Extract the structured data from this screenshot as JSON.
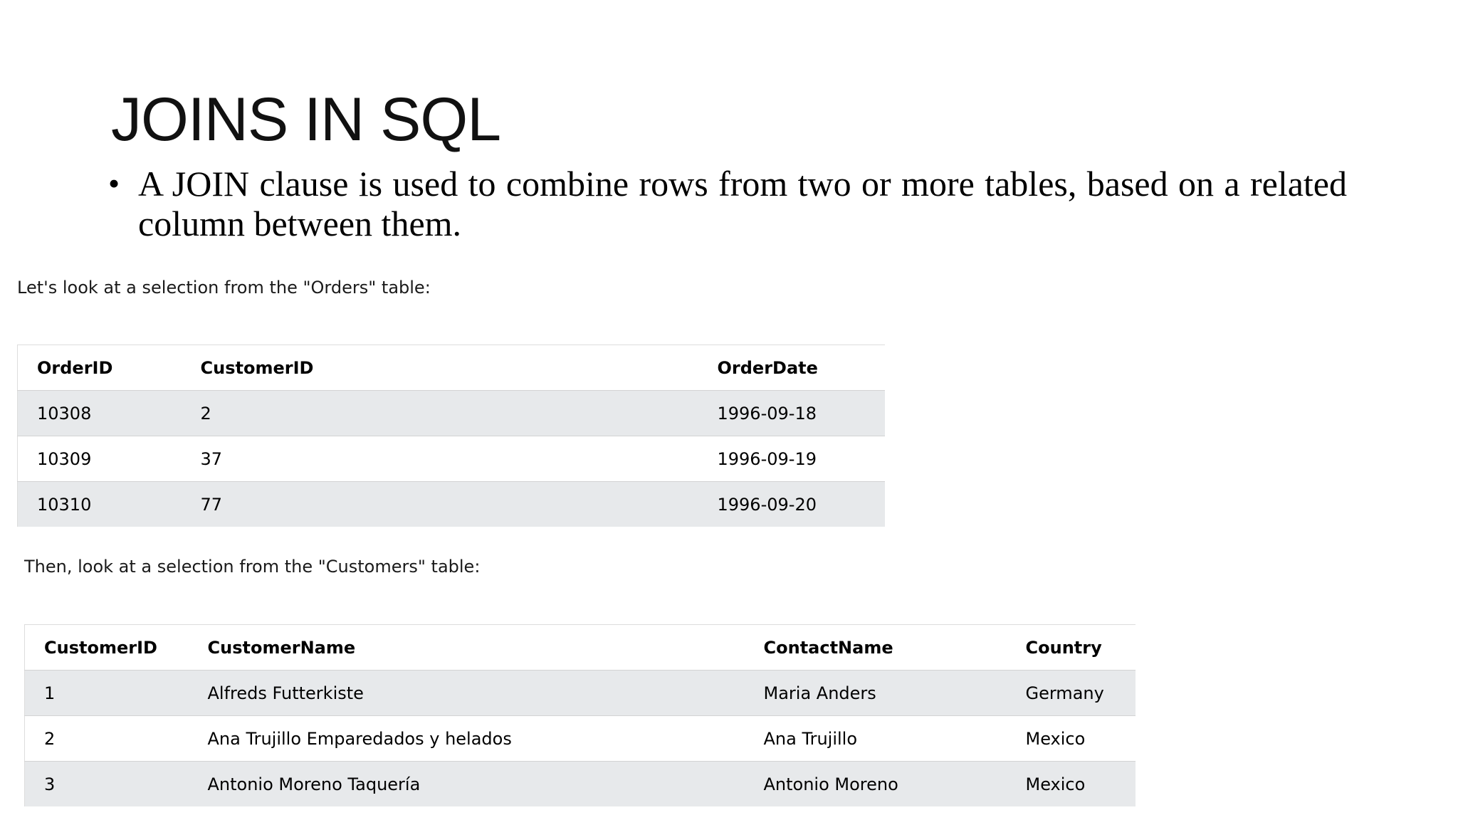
{
  "slide": {
    "title": "JOINS IN SQL",
    "bullet": {
      "symbol": "•",
      "text": "A JOIN clause is used to combine rows from two or more tables, based on a related column between them."
    }
  },
  "orders": {
    "caption": "Let's look at a selection from the \"Orders\" table:",
    "headers": [
      "OrderID",
      "CustomerID",
      "OrderDate"
    ],
    "rows": [
      [
        "10308",
        "2",
        "1996-09-18"
      ],
      [
        "10309",
        "37",
        "1996-09-19"
      ],
      [
        "10310",
        "77",
        "1996-09-20"
      ]
    ]
  },
  "customers": {
    "caption": "Then, look at a selection from the \"Customers\" table:",
    "headers": [
      "CustomerID",
      "CustomerName",
      "ContactName",
      "Country"
    ],
    "rows": [
      [
        "1",
        "Alfreds Futterkiste",
        "Maria Anders",
        "Germany"
      ],
      [
        "2",
        "Ana Trujillo Emparedados y helados",
        "Ana Trujillo",
        "Mexico"
      ],
      [
        "3",
        "Antonio Moreno Taquería",
        "Antonio Moreno",
        "Mexico"
      ]
    ]
  },
  "colors": {
    "striped_row": "#e7e9eb",
    "text": "#000000"
  }
}
